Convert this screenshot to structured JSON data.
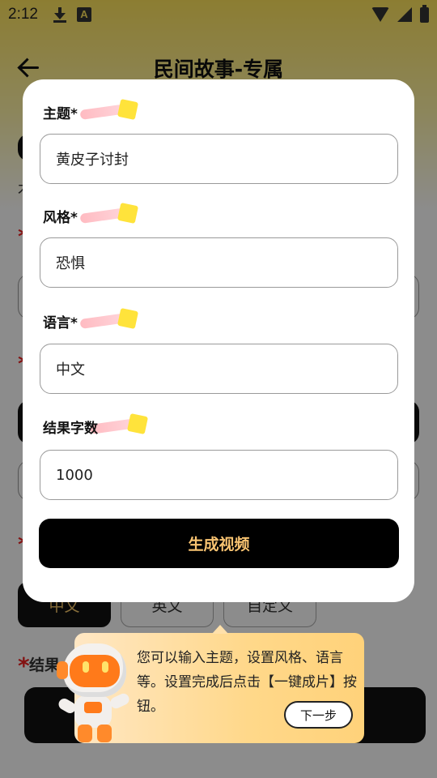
{
  "status_bar": {
    "time": "2:12",
    "notification_letter": "A"
  },
  "header": {
    "title": "民间故事-专属"
  },
  "background": {
    "partial_text": "木",
    "options": [
      "中文",
      "英文",
      "自定义"
    ],
    "section_label": "结果"
  },
  "form": {
    "fields": [
      {
        "label": "主题*",
        "value": "黄皮子讨封"
      },
      {
        "label": "风格*",
        "value": "恐惧"
      },
      {
        "label": "语言*",
        "value": "中文"
      },
      {
        "label": "结果字数",
        "value": "1000"
      }
    ],
    "submit_label": "生成视频"
  },
  "guide": {
    "message": "您可以输入主题，设置风格、语言等。设置完成后点击【一键成片】按钮。",
    "next_label": "下一步"
  },
  "colors": {
    "accent_yellow": "#ffe33b",
    "button_text_gold": "#f8c371",
    "guide_gradient_start": "#ffe7c4",
    "guide_gradient_end": "#ffd27a",
    "mascot_orange": "#ff7a1a"
  }
}
